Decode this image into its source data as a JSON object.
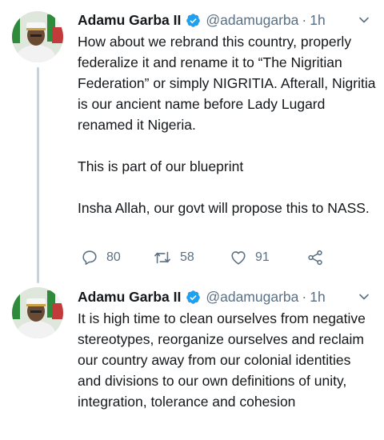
{
  "tweets": [
    {
      "author_name": "Adamu Garba II",
      "handle": "@adamugarba",
      "separator": "·",
      "time": "1h",
      "paragraphs": [
        "How about we rebrand this country, properly federalize it and rename it to “The Nigritian Federation” or simply NIGRITIA. Afterall, Nigritia is our ancient name before Lady Lugard renamed it Nigeria.",
        "This is part of our blueprint",
        "Insha Allah, our govt will propose this to NASS."
      ],
      "reply_count": "80",
      "retweet_count": "58",
      "like_count": "91"
    },
    {
      "author_name": "Adamu Garba II",
      "handle": "@adamugarba",
      "separator": "·",
      "time": "1h",
      "paragraphs": [
        "It is high time to clean ourselves from negative stereotypes, reorganize ourselves and reclaim our country away from our colonial identities and divisions to our own definitions of unity, integration, tolerance and cohesion"
      ]
    }
  ],
  "colors": {
    "text": "#14171a",
    "secondary": "#5b7083",
    "verified": "#1da1f2",
    "thread_line": "#c9d2d9"
  },
  "icons": {
    "verified": "verified-badge-icon",
    "more": "chevron-down-icon",
    "reply": "reply-icon",
    "retweet": "retweet-icon",
    "like": "heart-icon",
    "share": "share-icon"
  }
}
